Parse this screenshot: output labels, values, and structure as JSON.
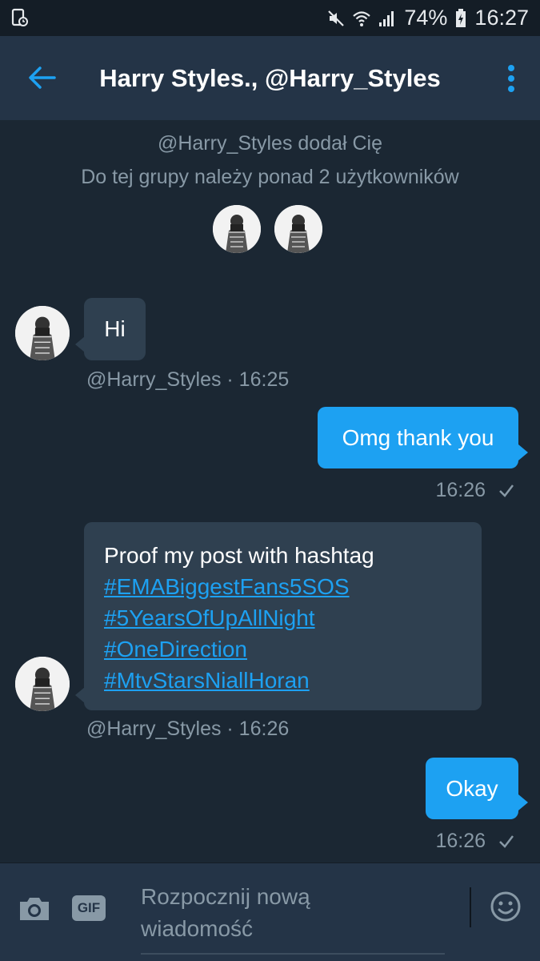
{
  "status_bar": {
    "battery": "74%",
    "time": "16:27"
  },
  "header": {
    "title": "Harry Styles., @Harry_Styles"
  },
  "system": {
    "added_by": "@Harry_Styles dodał Cię",
    "group_info": "Do tej grupy należy ponad 2 użytkowników"
  },
  "messages": [
    {
      "direction": "in",
      "text": "Hi",
      "meta": "@Harry_Styles · 16:25"
    },
    {
      "direction": "out",
      "text": "Omg thank you",
      "time": "16:26"
    },
    {
      "direction": "in",
      "text": "Proof my post with hashtag",
      "hashtags": [
        "#EMABiggestFans5SOS",
        "#5YearsOfUpAllNight",
        "#OneDirection",
        "#MtvStarsNiallHoran"
      ],
      "meta": "@Harry_Styles · 16:26"
    },
    {
      "direction": "out",
      "text": "Okay",
      "time": "16:26"
    }
  ],
  "composer": {
    "placeholder_line1": "Rozpocznij nową",
    "placeholder_line2": "wiadomość",
    "gif_label": "GIF"
  },
  "colors": {
    "accent": "#1da1f2",
    "background": "#1b2733",
    "header": "#243447",
    "incoming_bubble": "#2f4050",
    "muted_text": "#8899a6"
  }
}
